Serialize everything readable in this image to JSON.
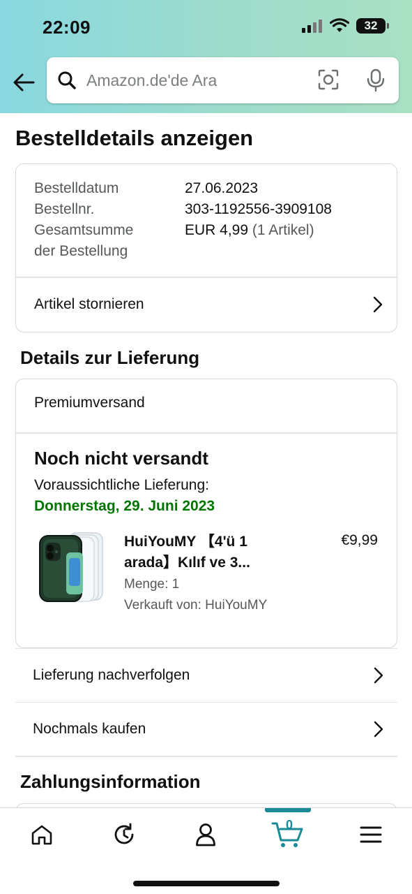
{
  "status_bar": {
    "time": "22:09",
    "battery_level": "32"
  },
  "search": {
    "placeholder": "Amazon.de'de Ara"
  },
  "page": {
    "title": "Bestelldetails anzeigen"
  },
  "order_summary": {
    "date_label": "Bestelldatum",
    "date_value": "27.06.2023",
    "number_label": "Bestellnr.",
    "number_value": "303-1192556-3909108",
    "total_label_line1": "Gesamtsumme",
    "total_label_line2": "der Bestellung",
    "total_value": "EUR 4,99",
    "total_items": "(1 Artikel)",
    "cancel_label": "Artikel stornieren"
  },
  "delivery": {
    "section_title": "Details zur Lieferung",
    "shipping_speed": "Premiumversand",
    "status": "Noch nicht versandt",
    "eta_label": "Voraussichtliche Lieferung:",
    "eta_date": "Donnerstag, 29. Juni 2023",
    "eta_color": "#007600",
    "item": {
      "title_line1": "HuiYouMY 【4'ü 1",
      "title_line2": "arada】Kılıf ve 3...",
      "price": "€9,99",
      "quantity": "Menge: 1",
      "seller": "Verkauft von: HuiYouMY"
    },
    "track_label": "Lieferung nachverfolgen",
    "buy_again_label": "Nochmals kaufen"
  },
  "payment": {
    "section_title": "Zahlungsinformation"
  },
  "bottom_nav": {
    "items": [
      {
        "icon": "home-icon"
      },
      {
        "icon": "refresh-icon"
      },
      {
        "icon": "account-icon"
      },
      {
        "icon": "cart-icon",
        "count": "0",
        "active": true
      },
      {
        "icon": "menu-icon"
      }
    ],
    "accent_color": "#1a8a99"
  }
}
